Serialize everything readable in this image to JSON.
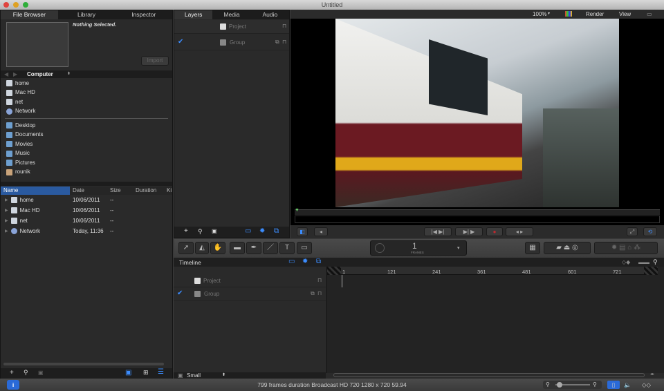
{
  "window": {
    "title": "Untitled"
  },
  "left_panel": {
    "tabs": [
      "File Browser",
      "Library",
      "Inspector"
    ],
    "nothing_selected": "Nothing Selected.",
    "import_label": "Import",
    "location": "Computer",
    "sidebar_devices": [
      {
        "label": "home",
        "icon": "drive-icon"
      },
      {
        "label": "Mac HD",
        "icon": "drive-icon"
      },
      {
        "label": "net",
        "icon": "drive-icon"
      },
      {
        "label": "Network",
        "icon": "network-icon"
      }
    ],
    "sidebar_places": [
      {
        "label": "Desktop",
        "icon": "folder-icon"
      },
      {
        "label": "Documents",
        "icon": "folder-icon"
      },
      {
        "label": "Movies",
        "icon": "folder-icon"
      },
      {
        "label": "Music",
        "icon": "folder-icon"
      },
      {
        "label": "Pictures",
        "icon": "folder-icon"
      },
      {
        "label": "rounik",
        "icon": "home-icon"
      }
    ],
    "columns": [
      "Name",
      "Date",
      "Size",
      "Duration",
      "Ki"
    ],
    "files": [
      {
        "name": "home",
        "date": "10/06/2011",
        "size": "--"
      },
      {
        "name": "Mac HD",
        "date": "10/06/2011",
        "size": "--"
      },
      {
        "name": "net",
        "date": "10/06/2011",
        "size": "--"
      },
      {
        "name": "Network",
        "date": "Today, 11:36",
        "size": "--"
      }
    ]
  },
  "layers_panel": {
    "tabs": [
      "Layers",
      "Media",
      "Audio"
    ],
    "items": [
      {
        "label": "Project",
        "checked": false
      },
      {
        "label": "Group",
        "checked": true
      }
    ]
  },
  "viewer": {
    "zoom": "100%",
    "render": "Render",
    "view": "View"
  },
  "toolbar": {
    "frame_value": "1",
    "frame_unit": "FRAMES"
  },
  "timeline": {
    "title": "Timeline",
    "items": [
      {
        "label": "Project"
      },
      {
        "label": "Group",
        "checked": true
      }
    ],
    "ruler": [
      "1",
      "121",
      "241",
      "361",
      "481",
      "601",
      "721"
    ],
    "size_option": "Small"
  },
  "status": {
    "text": "799 frames duration Broadcast HD 720 1280 x 720 59.94"
  },
  "colors": {
    "accent": "#3c8dff",
    "record": "#c0282e",
    "background": "#2a2a2a"
  }
}
